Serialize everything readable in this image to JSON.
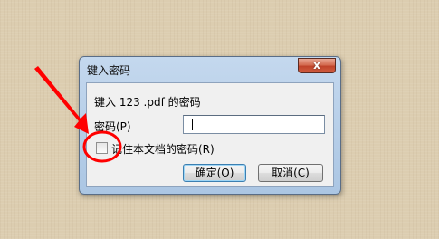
{
  "dialog": {
    "title": "键入密码",
    "close_glyph": "x",
    "prompt": "键入 123 .pdf 的密码",
    "password_label": "密码(P)",
    "password_value": "",
    "remember_label": "记住本文档的密码(R)",
    "remember_checked": false,
    "ok_label": "确定(O)",
    "cancel_label": "取消(C)"
  },
  "annotation": {
    "color": "#ff0000"
  }
}
